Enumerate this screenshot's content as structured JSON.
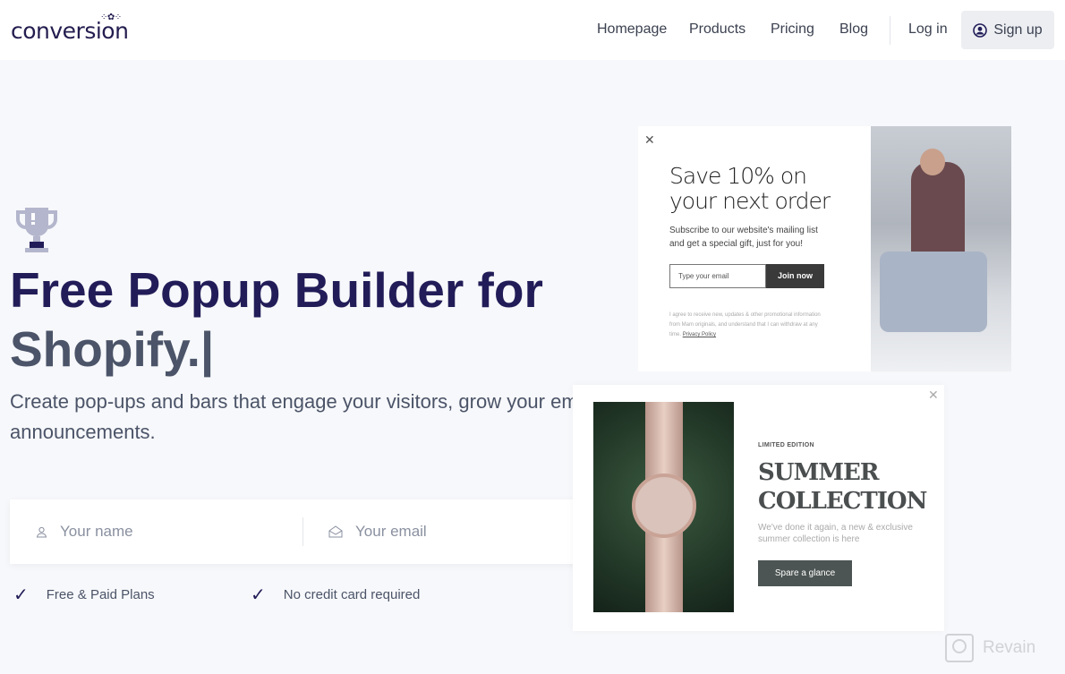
{
  "header": {
    "logo": "conversion",
    "nav": [
      "Homepage",
      "Products",
      "Pricing",
      "Blog"
    ],
    "login": "Log in",
    "signup": "Sign up"
  },
  "hero": {
    "title_line1": "Free Popup Builder for",
    "title_line2": "Shopify.|",
    "subtitle_line1": "Create pop-ups and bars that engage your visitors, grow your email list, and make",
    "subtitle_line2": "announcements."
  },
  "form": {
    "name_placeholder": "Your name",
    "email_placeholder": "Your email"
  },
  "checks": [
    "Free & Paid Plans",
    "No credit card required"
  ],
  "popup1": {
    "title_line1": "Save 10% on",
    "title_line2": "your next order",
    "text_line1": "Subscribe to our website's mailing list",
    "text_line2": "and get a special gift, just for you!",
    "email_placeholder": "Type your email",
    "button": "Join now",
    "legal": "I agree to receive new, updates & other promotional information from Mam originals, and understand that I can withdraw at any time.",
    "privacy": "Privacy Policy"
  },
  "popup2": {
    "eyebrow": "LIMITED EDITION",
    "title_line1": "SUMMER",
    "title_line2": "COLLECTION",
    "text_line1": "We've done it again, a new & exclusive",
    "text_line2": "summer collection is here",
    "button": "Spare a glance"
  },
  "watermark": "Revain",
  "colors": {
    "brand": "#221d58",
    "text": "#4b5468",
    "page_bg": "#f7f8fb"
  }
}
